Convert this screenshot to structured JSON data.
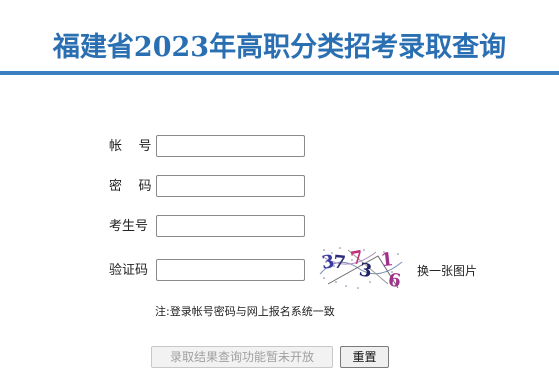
{
  "page": {
    "title": "福建省2023年高职分类招考录取查询"
  },
  "form": {
    "account_label": "帐    号",
    "account_value": "",
    "password_label": "密    码",
    "password_value": "",
    "exam_no_label": "考生号",
    "exam_no_value": "",
    "captcha_label": "验证码",
    "captcha_value": "",
    "captcha_chars": [
      "3",
      "7",
      "7",
      "3",
      "1",
      "6"
    ],
    "captcha_colors": [
      "#3a3aa0",
      "#2c2c7a",
      "#c0307a",
      "#222266",
      "#a0308a",
      "#a0308a"
    ],
    "refresh_captcha_label": "换一张图片",
    "note": "注:登录帐号密码与网上报名系统一致"
  },
  "buttons": {
    "query_disabled_label": "录取结果查询功能暂未开放",
    "reset_label": "重置"
  },
  "colors": {
    "title": "#2a6fb2",
    "title_rule": "#3b7fc0"
  }
}
